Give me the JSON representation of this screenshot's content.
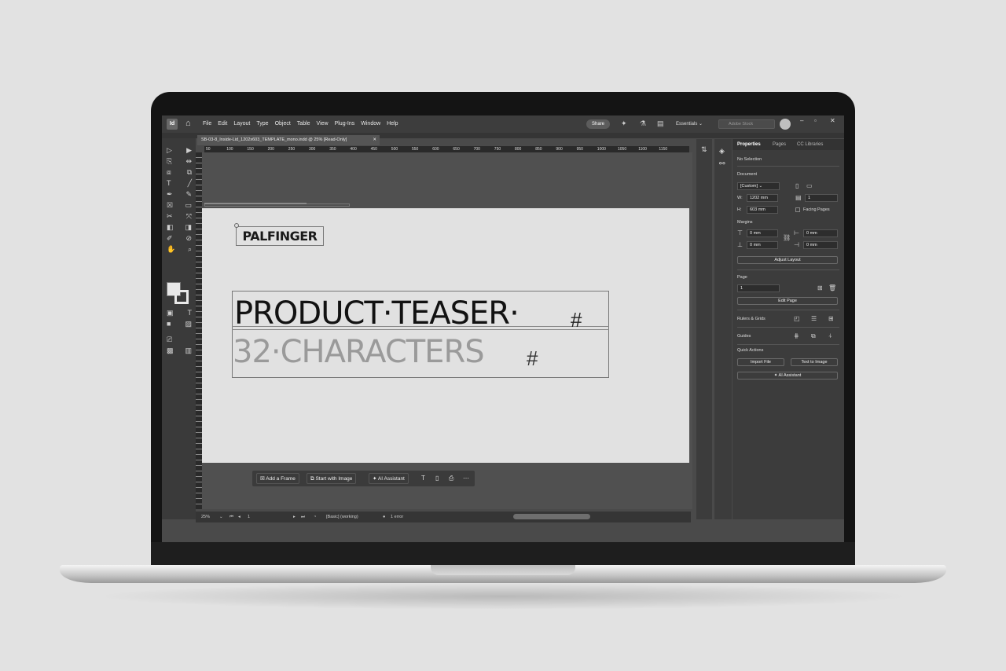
{
  "app": {
    "logo": "Id",
    "menus": [
      "File",
      "Edit",
      "Layout",
      "Type",
      "Object",
      "Table",
      "View",
      "Plug-Ins",
      "Window",
      "Help"
    ],
    "share_label": "Share",
    "workspace": "Essentials",
    "stock_placeholder": "Adobe Stock"
  },
  "document": {
    "tab_title": "SB-03-8_Inside-Lid_1202x603_TEMPLATE_mono.indd @ 25% [Read-Only]",
    "ruler_marks": [
      "50",
      "100",
      "150",
      "200",
      "250",
      "300",
      "350",
      "400",
      "450",
      "500",
      "550",
      "600",
      "650",
      "700",
      "750",
      "800",
      "850",
      "900",
      "950",
      "1000",
      "1050",
      "1100",
      "1150"
    ]
  },
  "canvas": {
    "logo_text": "PALFINGER",
    "headline": "PRODUCT·TEASER·",
    "headline_mark": "#",
    "subline": "32·CHARACTERS",
    "subline_mark": "#"
  },
  "contextual_taskbar": {
    "add_frame": "Add a Frame",
    "start_with_image": "Start with Image",
    "ai_assistant": "AI Assistant"
  },
  "status": {
    "zoom": "25%",
    "page": "1",
    "style": "[Basic] (working)",
    "errors": "1 error"
  },
  "properties": {
    "tabs": [
      "Properties",
      "Pages",
      "CC Libraries"
    ],
    "selection": "No Selection",
    "document_label": "Document",
    "preset": "[Custom]",
    "width_label": "W:",
    "width": "1202 mm",
    "height_label": "H:",
    "height": "603 mm",
    "pages_count": "1",
    "facing_pages": "Facing Pages",
    "margins_label": "Margins",
    "margin_top": "0 mm",
    "margin_bottom": "0 mm",
    "margin_inside": "0 mm",
    "margin_outside": "0 mm",
    "adjust_layout": "Adjust Layout",
    "page_label": "Page",
    "page_value": "1",
    "edit_page": "Edit Page",
    "rulers_grids": "Rulers & Grids",
    "guides": "Guides",
    "quick_actions": "Quick Actions",
    "import_file": "Import File",
    "text_to_image": "Text to Image",
    "ai_assistant": "AI Assistant"
  }
}
